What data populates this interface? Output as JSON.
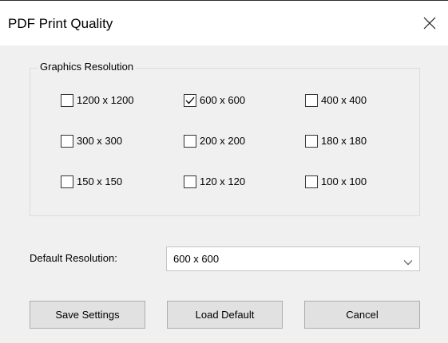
{
  "window": {
    "title": "PDF Print Quality",
    "close_icon": "close-icon"
  },
  "graphics_resolution": {
    "legend": "Graphics Resolution",
    "options": [
      {
        "label": "1200 x 1200",
        "checked": false
      },
      {
        "label": "600 x 600",
        "checked": true
      },
      {
        "label": "400 x 400",
        "checked": false
      },
      {
        "label": "300 x 300",
        "checked": false
      },
      {
        "label": "200 x 200",
        "checked": false
      },
      {
        "label": "180 x 180",
        "checked": false
      },
      {
        "label": "150 x 150",
        "checked": false
      },
      {
        "label": "120 x 120",
        "checked": false
      },
      {
        "label": "100 x 100",
        "checked": false
      }
    ]
  },
  "default_resolution": {
    "label": "Default Resolution:",
    "value": "600 x 600",
    "dropdown_icon": "chevron-down-icon"
  },
  "buttons": {
    "save": "Save Settings",
    "load_default": "Load Default",
    "cancel": "Cancel"
  }
}
